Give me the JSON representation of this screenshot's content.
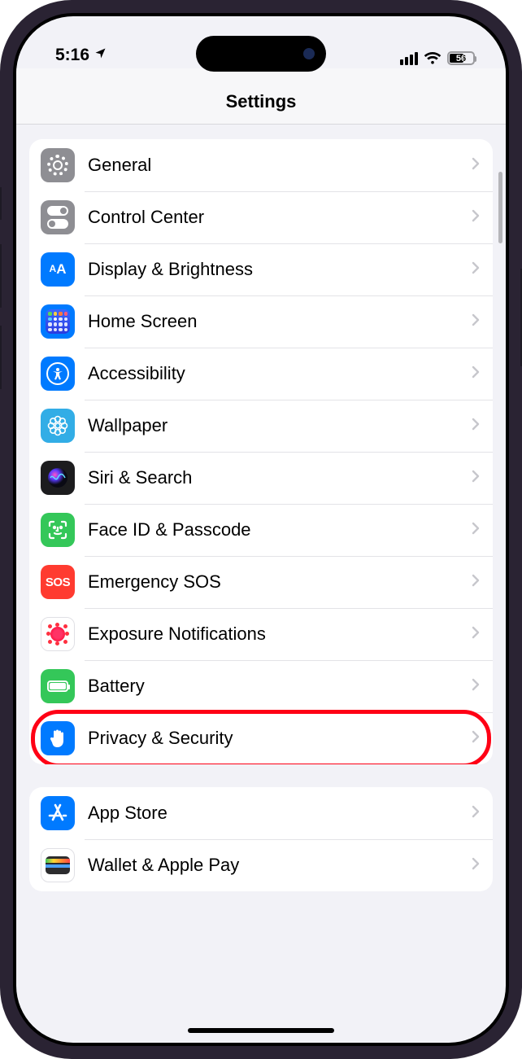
{
  "status": {
    "time": "5:16",
    "battery": "56"
  },
  "header": {
    "title": "Settings"
  },
  "groups": [
    {
      "items": [
        {
          "id": "general",
          "label": "General",
          "icon": "gear-icon",
          "iconClass": "ic-gray",
          "highlighted": false
        },
        {
          "id": "control-center",
          "label": "Control Center",
          "icon": "switches-icon",
          "iconClass": "ic-gray",
          "highlighted": false
        },
        {
          "id": "display-brightness",
          "label": "Display & Brightness",
          "icon": "aa-icon",
          "iconClass": "ic-blue",
          "highlighted": false
        },
        {
          "id": "home-screen",
          "label": "Home Screen",
          "icon": "app-grid-icon",
          "iconClass": "ic-blue",
          "highlighted": false
        },
        {
          "id": "accessibility",
          "label": "Accessibility",
          "icon": "accessibility-icon",
          "iconClass": "ic-blue",
          "highlighted": false
        },
        {
          "id": "wallpaper",
          "label": "Wallpaper",
          "icon": "flower-icon",
          "iconClass": "ic-cyan",
          "highlighted": false
        },
        {
          "id": "siri-search",
          "label": "Siri & Search",
          "icon": "siri-icon",
          "iconClass": "ic-black",
          "highlighted": false
        },
        {
          "id": "face-id-passcode",
          "label": "Face ID & Passcode",
          "icon": "face-id-icon",
          "iconClass": "ic-green",
          "highlighted": false
        },
        {
          "id": "emergency-sos",
          "label": "Emergency SOS",
          "icon": "sos-icon",
          "iconClass": "ic-red",
          "highlighted": false
        },
        {
          "id": "exposure-notifications",
          "label": "Exposure Notifications",
          "icon": "virus-icon",
          "iconClass": "ic-white",
          "highlighted": false
        },
        {
          "id": "battery",
          "label": "Battery",
          "icon": "battery-icon",
          "iconClass": "ic-green",
          "highlighted": false
        },
        {
          "id": "privacy-security",
          "label": "Privacy & Security",
          "icon": "hand-icon",
          "iconClass": "ic-blue",
          "highlighted": true
        }
      ]
    },
    {
      "items": [
        {
          "id": "app-store",
          "label": "App Store",
          "icon": "appstore-icon",
          "iconClass": "ic-blue",
          "highlighted": false
        },
        {
          "id": "wallet-apple-pay",
          "label": "Wallet & Apple Pay",
          "icon": "wallet-icon",
          "iconClass": "ic-multi",
          "highlighted": false
        }
      ]
    }
  ]
}
